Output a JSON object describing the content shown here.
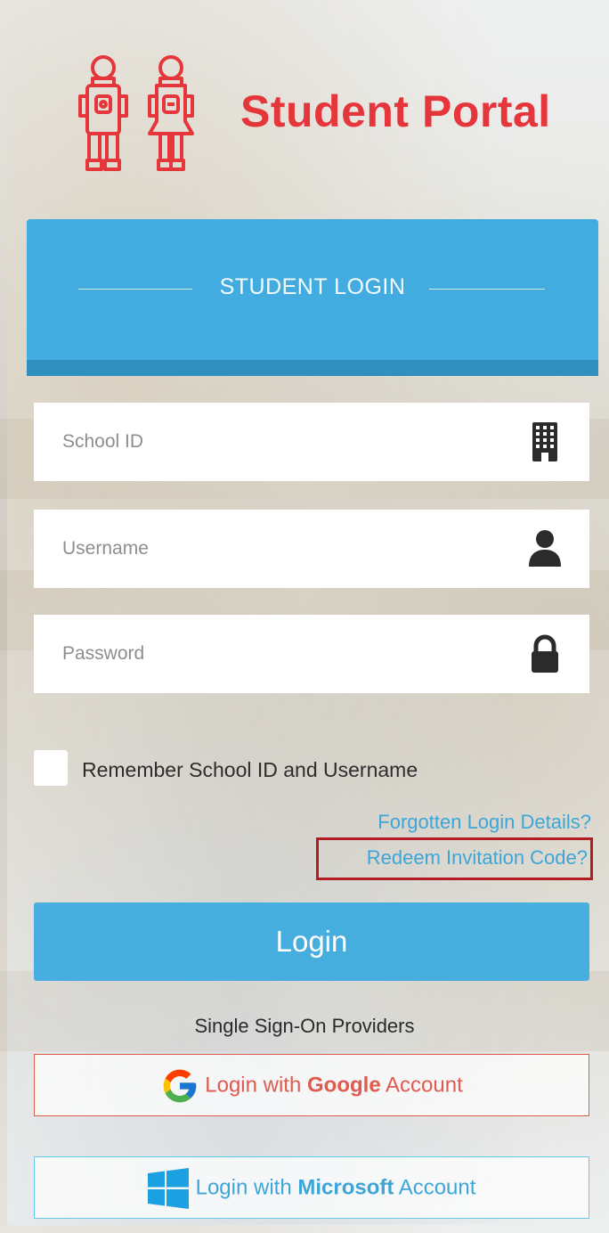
{
  "header": {
    "title": "Student Portal",
    "logo_icon": "student-figures-icon"
  },
  "banner": {
    "title": "STUDENT LOGIN"
  },
  "form": {
    "school_id_placeholder": "School ID",
    "username_placeholder": "Username",
    "password_placeholder": "Password",
    "school_id_icon": "building-icon",
    "username_icon": "user-icon",
    "password_icon": "lock-icon",
    "remember_label": "Remember School ID and Username",
    "remember_checked": false
  },
  "links": {
    "forgotten": "Forgotten Login Details?",
    "redeem": "Redeem Invitation Code?"
  },
  "login_button": "Login",
  "sso": {
    "label": "Single Sign-On Providers",
    "google": {
      "prefix": "Login with ",
      "brand": "Google",
      "suffix": " Account"
    },
    "microsoft": {
      "prefix": "Login with ",
      "brand": "Microsoft",
      "suffix": " Account"
    }
  },
  "colors": {
    "brand_red": "#e5373b",
    "accent_blue": "#42ace0",
    "banner_stripe": "#2f8fbf",
    "link_blue": "#3ea5d8",
    "highlight_red": "#b31c22"
  }
}
